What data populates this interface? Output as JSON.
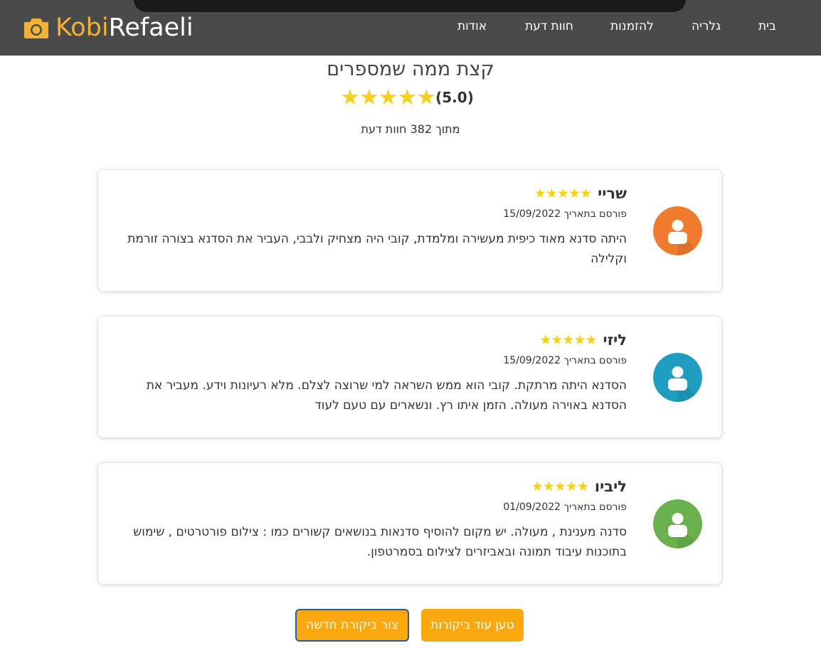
{
  "nav": {
    "brand_first": "Kobi",
    "brand_second": "Refaeli",
    "links": [
      "בית",
      "גלריה",
      "להזמנות",
      "חוות דעת",
      "אודות"
    ]
  },
  "summary": {
    "title": "קצת ממה שמספרים",
    "rating_text": "(5.0)",
    "stars": "★★★★★",
    "count_text": "מתוך 382 חוות דעת"
  },
  "reviews": [
    {
      "name": "שריי",
      "stars": "★★★★★",
      "date": "פורסם בתאריך 15/09/2022",
      "text": "היתה סדנא מאוד כיפית מעשירה ומלמדת, קובי היה מצחיק ולבבי, העביר את הסדנא בצורה זורמת וקלילה",
      "avatar_color": "#f07b2e"
    },
    {
      "name": "ליזי",
      "stars": "★★★★★",
      "date": "פורסם בתאריך 15/09/2022",
      "text": "הסדנא היתה מרתקת. קובי הוא ממש השראה למי שרוצה לצלם. מלא רעיונות וידע. מעביר את הסדנא באוירה מעולה. הזמן איתו רץ. ונשארים עם טעם לעוד",
      "avatar_color": "#1e9dc0"
    },
    {
      "name": "ליביו",
      "stars": "★★★★★",
      "date": "פורסם בתאריך 01/09/2022",
      "text": "סדנה מענינת , מעולה. יש מקום להוסיף סדנאות בנושאים קשורים כמו : צילום פורטרטים , שימוש בתוכנות עיבוד תמונה ובאביזרים לצילום בסמרטפון.",
      "avatar_color": "#6ab04c"
    }
  ],
  "buttons": {
    "new_review": "צור ביקורת חדשה",
    "load_more": "טען עוד ביקורות"
  },
  "colors": {
    "accent": "#f9a90f",
    "brand": "#f2b233",
    "star": "#f7d01a",
    "navbar": "#4a4a4a"
  }
}
